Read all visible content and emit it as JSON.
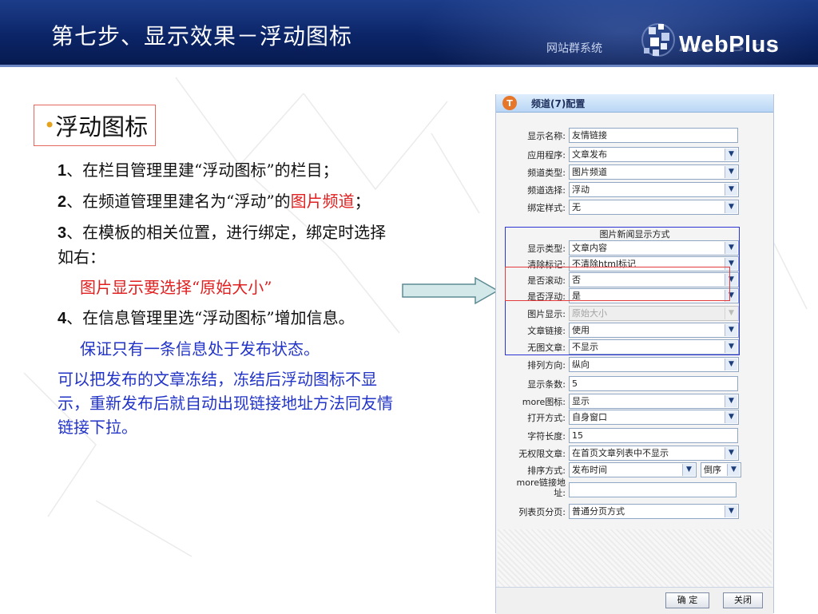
{
  "header": {
    "slide_title": "第七步、显示效果－浮动图标",
    "brand_cn": "网站群系统",
    "brand_name": "WebPlus"
  },
  "left": {
    "heading": "浮动图标",
    "steps": [
      {
        "num": "1",
        "text": "、在栏目管理里建“浮动图标”的栏目；"
      },
      {
        "num": "2",
        "text_before": "、在频道管理里建名为“浮动”的",
        "highlight": "图片频道",
        "text_after": "；"
      },
      {
        "num": "3",
        "text": "、在模板的相关位置，进行绑定，绑定时选择如右："
      },
      {
        "note_red": "图片显示要选择“原始大小”"
      },
      {
        "num": "4",
        "text": "、在信息管理里选“浮动图标”增加信息。"
      },
      {
        "note_blue_1": "保证只有一条信息处于发布状态。"
      },
      {
        "note_blue_2": "可以把发布的文章冻结，冻结后浮动图标不显示，重新发布后就自动出现链接地址方法同友情链接下拉。"
      }
    ]
  },
  "dialog": {
    "title": "频道(7)配置",
    "group_title": "图片新闻显示方式",
    "rows": [
      {
        "label": "显示名称:",
        "value": "友情链接"
      },
      {
        "label": "应用程序:",
        "value": "文章发布"
      },
      {
        "label": "频道类型:",
        "value": "图片频道"
      },
      {
        "label": "频道选择:",
        "value": "浮动"
      },
      {
        "label": "绑定样式:",
        "value": "无"
      },
      {
        "label": "显示类型:",
        "value": "文章内容"
      },
      {
        "label": "清除标记:",
        "value": "不清除html标记"
      },
      {
        "label": "是否滚动:",
        "value": "否"
      },
      {
        "label": "是否浮动:",
        "value": "是"
      },
      {
        "label": "图片显示:",
        "value": "原始大小"
      },
      {
        "label": "文章链接:",
        "value": "使用"
      },
      {
        "label": "无图文章:",
        "value": "不显示"
      },
      {
        "label": "排列方向:",
        "value": "纵向"
      },
      {
        "label": "显示条数:",
        "value": "5"
      },
      {
        "label": "more图标:",
        "value": "显示"
      },
      {
        "label": "打开方式:",
        "value": "自身窗口"
      },
      {
        "label": "字符长度:",
        "value": "15"
      },
      {
        "label": "无权限文章:",
        "value": "在首页文章列表中不显示"
      },
      {
        "label": "排序方式:",
        "value": "发布时间",
        "order": "倒序"
      },
      {
        "label_line1": "more链接地",
        "label_line2": "址:",
        "value": ""
      },
      {
        "label": "列表页分页:",
        "value": "普通分页方式"
      }
    ],
    "ok_label": "确 定",
    "close_label": "关闭"
  },
  "colors": {
    "header_bg": "#0b2466",
    "highlight_red": "#e02020",
    "highlight_blue": "#2233c8",
    "group_box": "#2c35d4",
    "mark_box": "#e23c3c"
  }
}
